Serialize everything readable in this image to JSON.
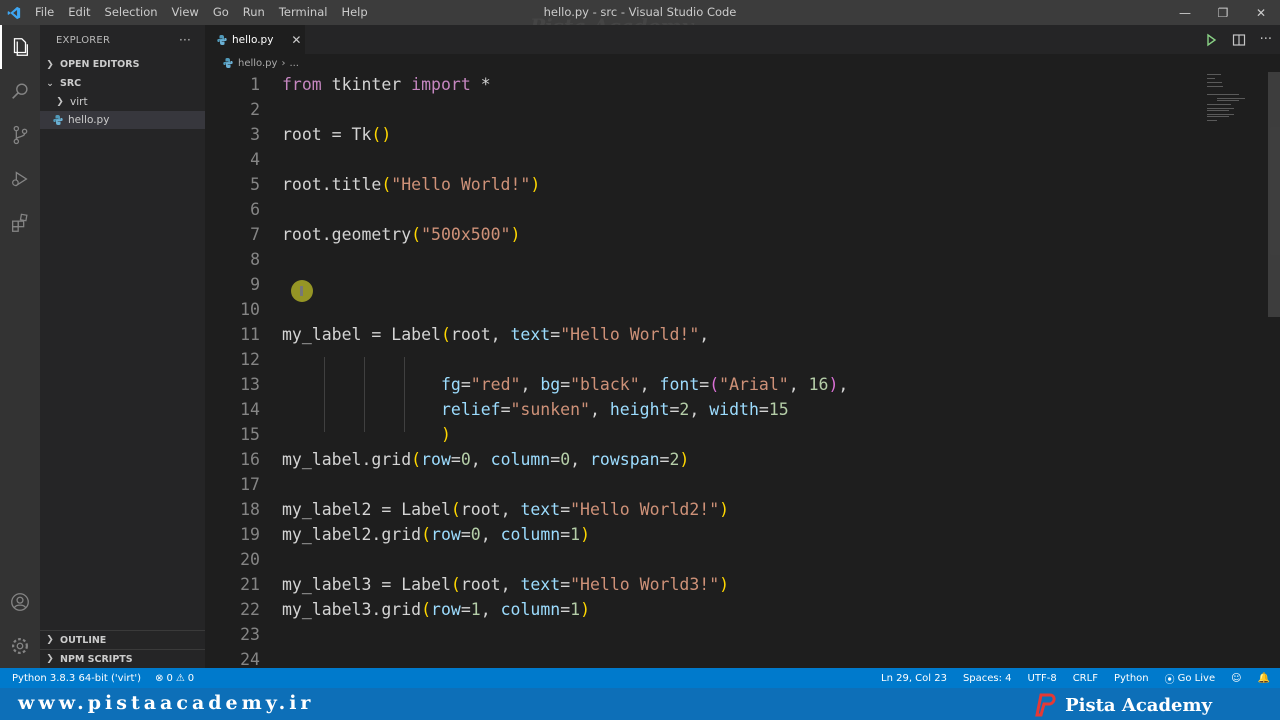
{
  "window": {
    "title": "hello.py - src - Visual Studio Code",
    "watermark": "Pista Academy"
  },
  "menu": [
    "File",
    "Edit",
    "Selection",
    "View",
    "Go",
    "Run",
    "Terminal",
    "Help"
  ],
  "sidebar": {
    "header": "EXPLORER",
    "more": "···",
    "open_editors": "OPEN EDITORS",
    "folder": "SRC",
    "items": [
      {
        "label": "virt",
        "type": "folder"
      },
      {
        "label": "hello.py",
        "type": "python-file",
        "selected": true
      }
    ],
    "outline": "OUTLINE",
    "npm_scripts": "NPM SCRIPTS"
  },
  "tab": {
    "label": "hello.py",
    "close": "✕"
  },
  "breadcrumb": {
    "file": "hello.py",
    "rest": "..."
  },
  "editor": {
    "lines": [
      {
        "n": "1"
      },
      {
        "n": "2"
      },
      {
        "n": "3"
      },
      {
        "n": "4"
      },
      {
        "n": "5"
      },
      {
        "n": "6"
      },
      {
        "n": "7"
      },
      {
        "n": "8"
      },
      {
        "n": "9"
      },
      {
        "n": "10"
      },
      {
        "n": "11"
      },
      {
        "n": "12"
      },
      {
        "n": "13"
      },
      {
        "n": "14"
      },
      {
        "n": "15"
      },
      {
        "n": "16"
      },
      {
        "n": "17"
      },
      {
        "n": "18"
      },
      {
        "n": "19"
      },
      {
        "n": "20"
      },
      {
        "n": "21"
      },
      {
        "n": "22"
      },
      {
        "n": "23"
      },
      {
        "n": "24"
      }
    ]
  },
  "statusbar": {
    "interpreter": "Python 3.8.3 64-bit ('virt')",
    "errors": "0",
    "warnings": "0",
    "position": "Ln 29, Col 23",
    "spaces": "Spaces: 4",
    "encoding": "UTF-8",
    "eol": "CRLF",
    "language": "Python",
    "golive": "Go Live"
  },
  "footer": {
    "url": "www.pistaacademy.ir",
    "brand": "Pista Academy"
  },
  "colors": {
    "accent": "#007acc",
    "keyword": "#c586c0",
    "string": "#ce9178",
    "function": "#dcdcaa",
    "variable": "#9cdcfe",
    "number": "#b5cea8"
  }
}
